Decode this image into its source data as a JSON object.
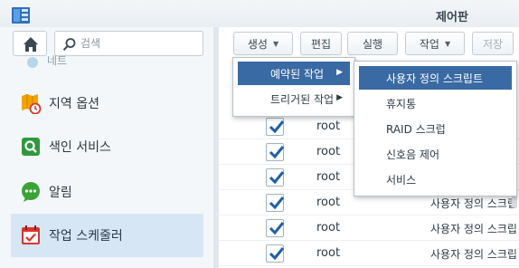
{
  "window": {
    "title": "제어판"
  },
  "sidebar": {
    "search_placeholder": "검색",
    "partial_item_label": "네트",
    "items": [
      {
        "label": "지역 옵션",
        "icon": "regional-options-icon"
      },
      {
        "label": "색인 서비스",
        "icon": "indexing-service-icon"
      },
      {
        "label": "알림",
        "icon": "notification-icon"
      },
      {
        "label": "작업 스케줄러",
        "icon": "task-scheduler-icon",
        "active": true
      }
    ]
  },
  "toolbar": {
    "create_label": "생성",
    "edit_label": "편집",
    "run_label": "실행",
    "action_label": "작업",
    "save_label": "저장"
  },
  "create_menu": {
    "items": [
      {
        "label": "예약된 작업",
        "highlighted": true
      },
      {
        "label": "트리거된 작업",
        "highlighted": false
      }
    ]
  },
  "scheduled_submenu": {
    "items": [
      {
        "label": "사용자 정의 스크립트",
        "highlighted": true
      },
      {
        "label": "휴지통"
      },
      {
        "label": "RAID 스크럽"
      },
      {
        "label": "신호음 제어"
      },
      {
        "label": "서비스"
      }
    ]
  },
  "task_rows": [
    {
      "checked": true,
      "owner": "root",
      "type": ""
    },
    {
      "checked": true,
      "owner": "root",
      "type": ""
    },
    {
      "checked": true,
      "owner": "root",
      "type": ""
    },
    {
      "checked": true,
      "owner": "root",
      "type": "사용자 정의 스크립"
    },
    {
      "checked": true,
      "owner": "root",
      "type": "사용자 정의 스크립"
    },
    {
      "checked": true,
      "owner": "root",
      "type": "사용자 정의 스크립"
    }
  ],
  "colors": {
    "accent": "#3a6aa3",
    "checkbox_blue": "#1f5fa8",
    "sidebar_active": "#d6e6f5"
  }
}
